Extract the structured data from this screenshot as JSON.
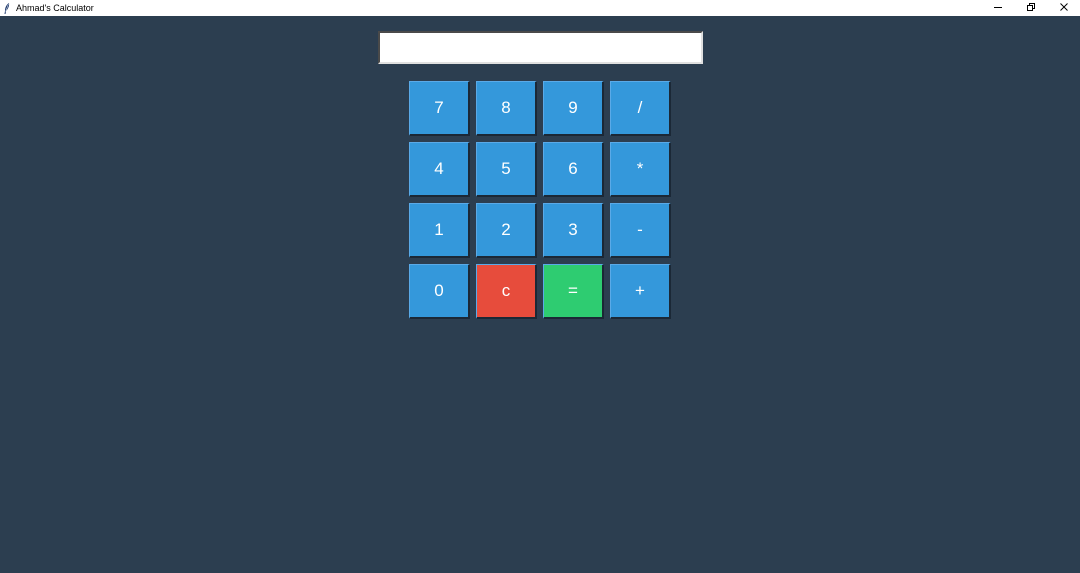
{
  "window": {
    "title": "Ahmad's Calculator",
    "controls": {
      "minimize_icon": "minimize-icon",
      "restore_icon": "restore-icon",
      "close_icon": "close-icon"
    }
  },
  "display": {
    "value": "",
    "placeholder": ""
  },
  "colors": {
    "background": "#2c3e50",
    "number_key": "#3498db",
    "clear_key": "#e74c3c",
    "equals_key": "#2ecc71",
    "key_text": "#ffffff"
  },
  "keys": [
    {
      "label": "7",
      "name": "key-7-button",
      "color": "#3498db"
    },
    {
      "label": "8",
      "name": "key-8-button",
      "color": "#3498db"
    },
    {
      "label": "9",
      "name": "key-9-button",
      "color": "#3498db"
    },
    {
      "label": "/",
      "name": "key-divide-button",
      "color": "#3498db"
    },
    {
      "label": "4",
      "name": "key-4-button",
      "color": "#3498db"
    },
    {
      "label": "5",
      "name": "key-5-button",
      "color": "#3498db"
    },
    {
      "label": "6",
      "name": "key-6-button",
      "color": "#3498db"
    },
    {
      "label": "*",
      "name": "key-multiply-button",
      "color": "#3498db"
    },
    {
      "label": "1",
      "name": "key-1-button",
      "color": "#3498db"
    },
    {
      "label": "2",
      "name": "key-2-button",
      "color": "#3498db"
    },
    {
      "label": "3",
      "name": "key-3-button",
      "color": "#3498db"
    },
    {
      "label": "-",
      "name": "key-subtract-button",
      "color": "#3498db"
    },
    {
      "label": "0",
      "name": "key-0-button",
      "color": "#3498db"
    },
    {
      "label": "c",
      "name": "clear-button",
      "color": "#e74c3c"
    },
    {
      "label": "=",
      "name": "equals-button",
      "color": "#2ecc71"
    },
    {
      "label": "+",
      "name": "key-add-button",
      "color": "#3498db"
    }
  ]
}
